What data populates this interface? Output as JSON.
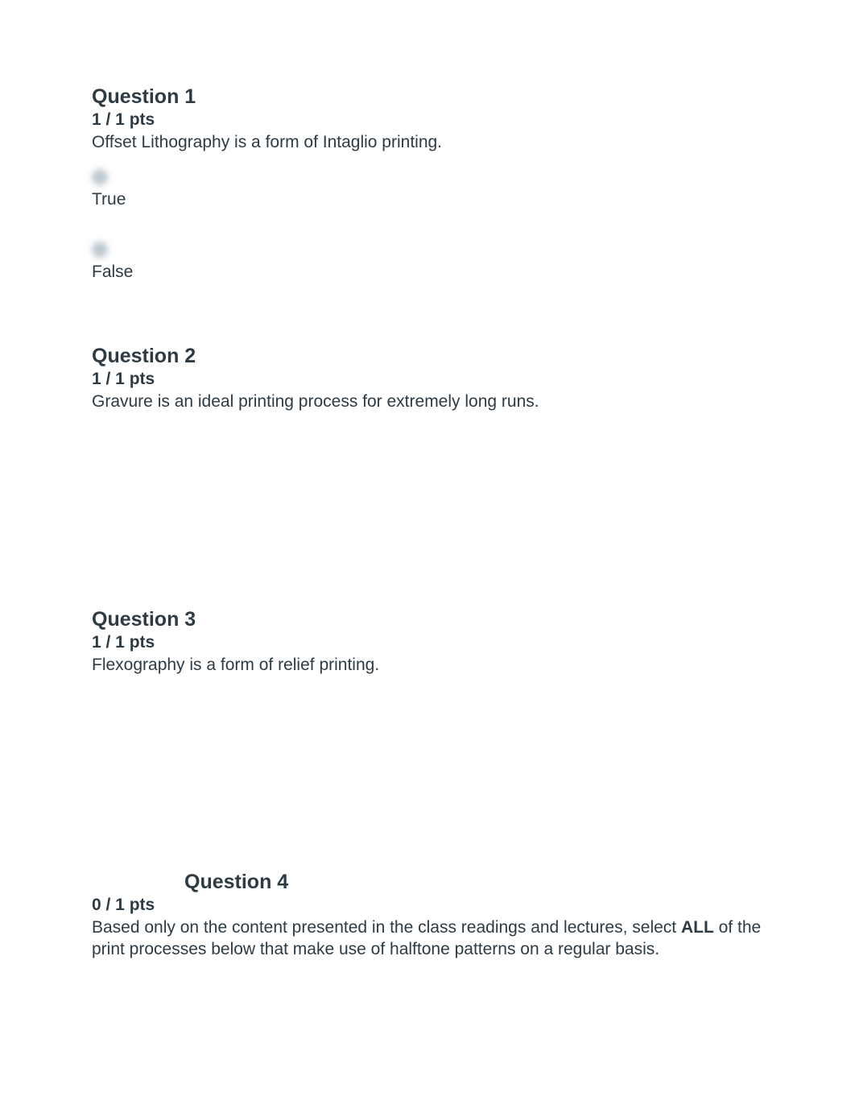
{
  "questions": {
    "q1": {
      "title": "Question 1",
      "points": "1 / 1 pts",
      "text": "Offset Lithography is a form of Intaglio printing.",
      "options": {
        "opt1": "True",
        "opt2": "False"
      }
    },
    "q2": {
      "title": "Question 2",
      "points": "1 / 1 pts",
      "text": "Gravure is an ideal printing process for extremely long runs."
    },
    "q3": {
      "title": "Question 3",
      "points": "1 / 1 pts",
      "text": "Flexography is a form of relief printing."
    },
    "q4": {
      "title": "Question 4",
      "points": "0 / 1 pts",
      "text_part1": "Based only on the content presented in the class readings and lectures, select ",
      "text_bold": "ALL",
      "text_part2": " of the print processes below that make use of halftone patterns on a regular basis."
    }
  }
}
